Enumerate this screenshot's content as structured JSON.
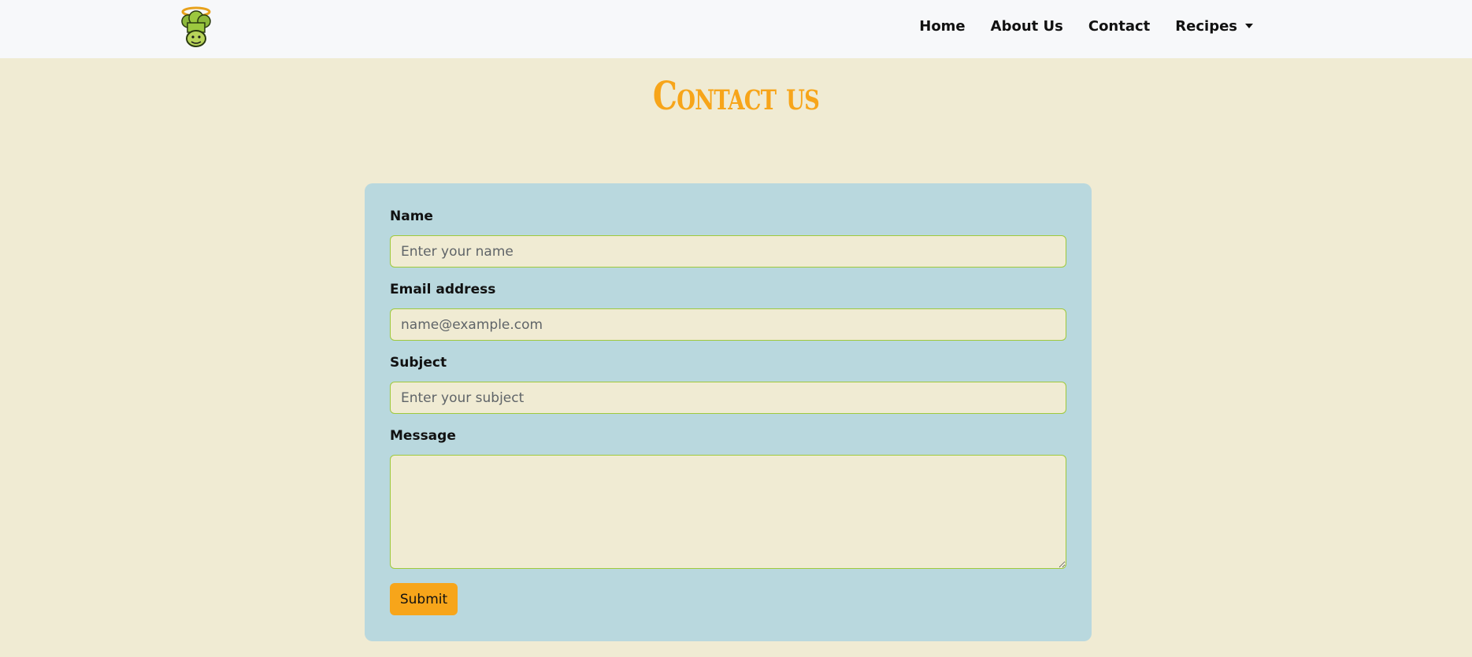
{
  "nav": {
    "logo_alt": "chef logo",
    "links": [
      {
        "label": "Home"
      },
      {
        "label": "About Us"
      },
      {
        "label": "Contact"
      },
      {
        "label": "Recipes"
      }
    ]
  },
  "page": {
    "title": "Contact us"
  },
  "form": {
    "name_label": "Name",
    "name_placeholder": "Enter your name",
    "email_label": "Email address",
    "email_placeholder": "name@example.com",
    "subject_label": "Subject",
    "subject_placeholder": "Enter your subject",
    "message_label": "Message",
    "submit_label": "Submit"
  },
  "colors": {
    "accent": "#f7a51a",
    "background": "#f0ebd3",
    "card": "#b9d8de",
    "input_border": "#9fc93c"
  }
}
